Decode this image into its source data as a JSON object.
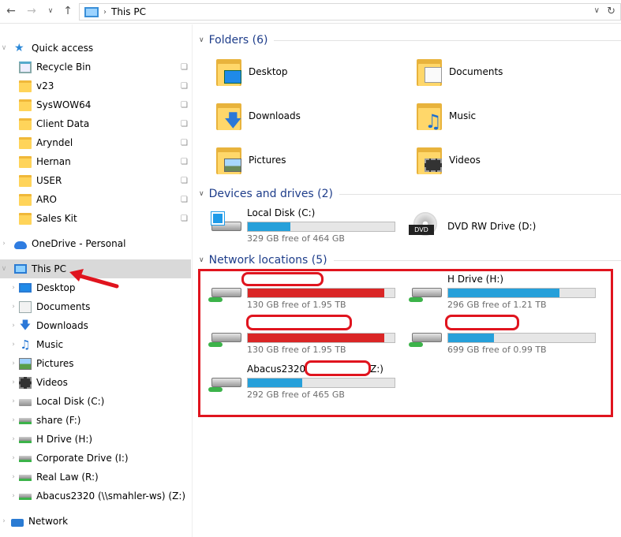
{
  "address": {
    "crumb": "This PC"
  },
  "sidebar": {
    "quick_access": "Quick access",
    "quick_items": [
      "Recycle Bin",
      "v23",
      "SysWOW64",
      "Client Data",
      "Aryndel",
      "Hernan",
      "USER",
      "ARO",
      "Sales Kit"
    ],
    "onedrive": "OneDrive - Personal",
    "this_pc": "This PC",
    "pc_items": [
      "Desktop",
      "Documents",
      "Downloads",
      "Music",
      "Pictures",
      "Videos",
      "Local Disk (C:)",
      "share (F:)",
      "H Drive (H:)",
      "Corporate Drive (I:)",
      "Real Law (R:)",
      "Abacus2320 (\\\\smahler-ws) (Z:)"
    ],
    "network": "Network"
  },
  "sections": {
    "folders": "Folders (6)",
    "devices": "Devices and drives (2)",
    "network": "Network locations (5)"
  },
  "folders": [
    "Desktop",
    "Documents",
    "Downloads",
    "Music",
    "Pictures",
    "Videos"
  ],
  "devices": [
    {
      "name": "Local Disk (C:)",
      "free": "329 GB free of 464 GB",
      "used_fraction": 0.29
    },
    {
      "name": "DVD RW Drive (D:)"
    }
  ],
  "network_locations": [
    {
      "name": "",
      "free": "130 GB free of 1.95 TB",
      "used_fraction": 0.93,
      "color": "#da2626"
    },
    {
      "name": "H Drive (H:)",
      "free": "296 GB free of 1.21 TB",
      "used_fraction": 0.76,
      "color": "#26a0da"
    },
    {
      "name": "",
      "free": "130 GB free of 1.95 TB",
      "used_fraction": 0.93,
      "color": "#da2626"
    },
    {
      "name": "",
      "free": "699 GB free of 0.99 TB",
      "used_fraction": 0.31,
      "color": "#26a0da"
    },
    {
      "name": "Abacus2320",
      "name_suffix": "Z:)",
      "free": "292 GB free of 465 GB",
      "used_fraction": 0.37,
      "color": "#26a0da"
    }
  ],
  "colors": {
    "accent": "#26a0da",
    "warning": "#da2626",
    "annotation": "#e0141e"
  }
}
